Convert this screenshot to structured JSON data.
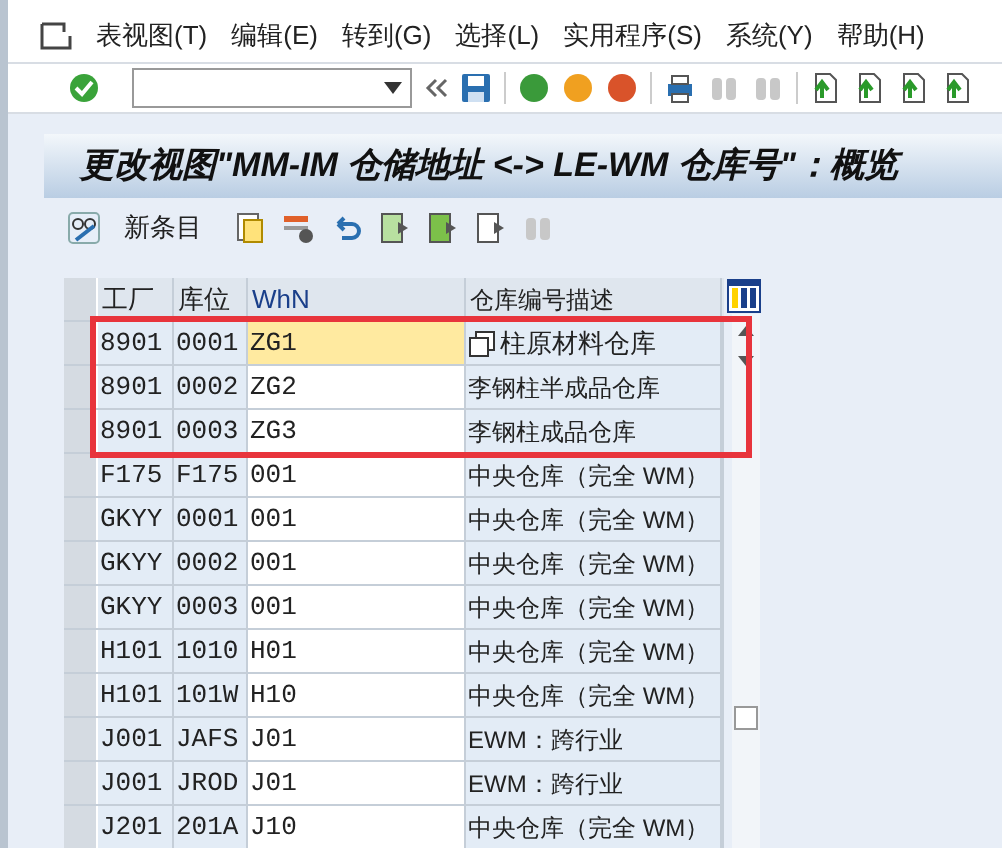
{
  "menu": [
    "表视图(T)",
    "编辑(E)",
    "转到(G)",
    "选择(L)",
    "实用程序(S)",
    "系统(Y)",
    "帮助(H)"
  ],
  "title": "更改视图\"MM-IM 仓储地址 <-> LE-WM 仓库号\"：概览",
  "app_toolbar": {
    "new_entries": "新条目"
  },
  "table": {
    "columns": [
      "工厂",
      "库位",
      "WhN",
      "仓库编号描述"
    ],
    "rows": [
      {
        "cells": [
          "8901",
          "0001",
          "ZG1",
          "柱原材料仓库"
        ],
        "focused": true,
        "highlighted": true
      },
      {
        "cells": [
          "8901",
          "0002",
          "ZG2",
          "李钢柱半成品仓库"
        ],
        "focused": false,
        "highlighted": true
      },
      {
        "cells": [
          "8901",
          "0003",
          "ZG3",
          "李钢柱成品仓库"
        ],
        "focused": false,
        "highlighted": true
      },
      {
        "cells": [
          "F175",
          "F175",
          "001",
          "中央仓库（完全 WM）"
        ],
        "focused": false,
        "highlighted": false
      },
      {
        "cells": [
          "GKYY",
          "0001",
          "001",
          "中央仓库（完全 WM）"
        ],
        "focused": false,
        "highlighted": false
      },
      {
        "cells": [
          "GKYY",
          "0002",
          "001",
          "中央仓库（完全 WM）"
        ],
        "focused": false,
        "highlighted": false
      },
      {
        "cells": [
          "GKYY",
          "0003",
          "001",
          "中央仓库（完全 WM）"
        ],
        "focused": false,
        "highlighted": false
      },
      {
        "cells": [
          "H101",
          "1010",
          "H01",
          "中央仓库（完全 WM）"
        ],
        "focused": false,
        "highlighted": false
      },
      {
        "cells": [
          "H101",
          "101W",
          "H10",
          "中央仓库（完全 WM）"
        ],
        "focused": false,
        "highlighted": false
      },
      {
        "cells": [
          "J001",
          "JAFS",
          "J01",
          "EWM：跨行业"
        ],
        "focused": false,
        "highlighted": false
      },
      {
        "cells": [
          "J001",
          "JROD",
          "J01",
          "EWM：跨行业"
        ],
        "focused": false,
        "highlighted": false
      },
      {
        "cells": [
          "J201",
          "201A",
          "J10",
          "中央仓库（完全 WM）"
        ],
        "focused": false,
        "highlighted": false
      }
    ]
  }
}
